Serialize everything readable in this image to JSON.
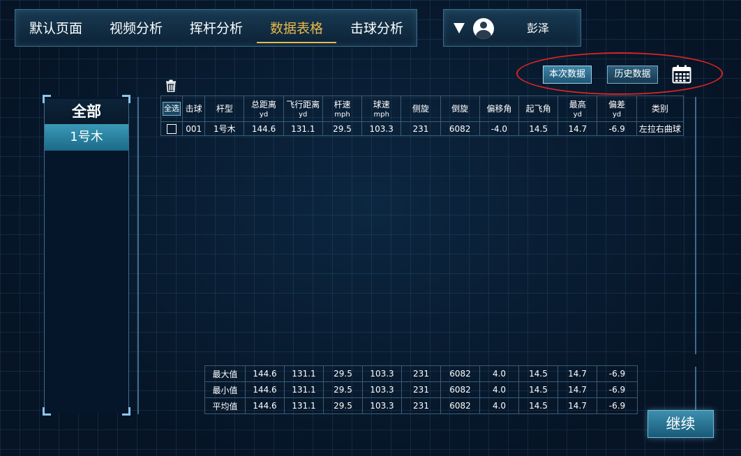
{
  "nav": {
    "tabs": [
      {
        "label": "默认页面",
        "active": false
      },
      {
        "label": "视频分析",
        "active": false
      },
      {
        "label": "挥杆分析",
        "active": false
      },
      {
        "label": "数据表格",
        "active": true
      },
      {
        "label": "击球分析",
        "active": false
      }
    ],
    "active_color": "#e8b94a"
  },
  "user": {
    "name": "彭泽",
    "avatar_icon": "user-avatar-icon",
    "dropdown_icon": "caret-down-icon"
  },
  "data_mode": {
    "current_label": "本次数据",
    "history_label": "历史数据",
    "calendar_icon": "calendar-icon",
    "highlight_color": "#d92424"
  },
  "categories": {
    "all_label": "全部",
    "items": [
      "1号木"
    ]
  },
  "table": {
    "delete_icon": "trash-icon",
    "select_all_label": "全选",
    "columns": [
      {
        "label": "击球",
        "unit": ""
      },
      {
        "label": "杆型",
        "unit": ""
      },
      {
        "label": "总距离",
        "unit": "yd"
      },
      {
        "label": "飞行距离",
        "unit": "yd"
      },
      {
        "label": "杆速",
        "unit": "mph"
      },
      {
        "label": "球速",
        "unit": "mph"
      },
      {
        "label": "侧旋",
        "unit": ""
      },
      {
        "label": "倒旋",
        "unit": ""
      },
      {
        "label": "偏移角",
        "unit": ""
      },
      {
        "label": "起飞角",
        "unit": ""
      },
      {
        "label": "最高",
        "unit": "yd"
      },
      {
        "label": "偏差",
        "unit": "yd"
      },
      {
        "label": "类别",
        "unit": ""
      }
    ],
    "rows": [
      {
        "checked": false,
        "cells": [
          "001",
          "1号木",
          "144.6",
          "131.1",
          "29.5",
          "103.3",
          "231",
          "6082",
          "-4.0",
          "14.5",
          "14.7",
          "-6.9",
          "左拉右曲球"
        ]
      }
    ]
  },
  "stats": {
    "rows": [
      {
        "label": "最大值",
        "values": [
          "144.6",
          "131.1",
          "29.5",
          "103.3",
          "231",
          "6082",
          "4.0",
          "14.5",
          "14.7",
          "-6.9"
        ]
      },
      {
        "label": "最小值",
        "values": [
          "144.6",
          "131.1",
          "29.5",
          "103.3",
          "231",
          "6082",
          "4.0",
          "14.5",
          "14.7",
          "-6.9"
        ]
      },
      {
        "label": "平均值",
        "values": [
          "144.6",
          "131.1",
          "29.5",
          "103.3",
          "231",
          "6082",
          "4.0",
          "14.5",
          "14.7",
          "-6.9"
        ]
      }
    ]
  },
  "continue_label": "继续"
}
